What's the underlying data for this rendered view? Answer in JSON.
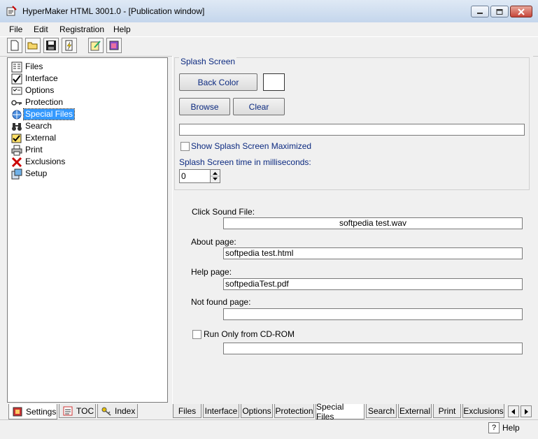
{
  "window": {
    "title": "HyperMaker HTML 3001.0 - [Publication window]"
  },
  "menu": [
    "File",
    "Edit",
    "Registration",
    "Help"
  ],
  "toolbar": {
    "buttons": [
      "new-document-icon",
      "open-folder-icon",
      "save-disk-icon",
      "build-icon",
      "edit-icon",
      "publication-icon"
    ]
  },
  "tree": {
    "items": [
      {
        "label": "Files",
        "icon": "files-icon"
      },
      {
        "label": "Interface",
        "icon": "interface-icon"
      },
      {
        "label": "Options",
        "icon": "options-icon"
      },
      {
        "label": "Protection",
        "icon": "key-icon"
      },
      {
        "label": "Special Files",
        "icon": "special-files-icon"
      },
      {
        "label": "Search",
        "icon": "binoculars-icon"
      },
      {
        "label": "External",
        "icon": "external-icon"
      },
      {
        "label": "Print",
        "icon": "printer-icon"
      },
      {
        "label": "Exclusions",
        "icon": "x-icon"
      },
      {
        "label": "Setup",
        "icon": "setup-icon"
      }
    ],
    "selected": "Special Files"
  },
  "left_tabs": [
    {
      "label": "Settings",
      "icon": "settings-icon",
      "active": true
    },
    {
      "label": "TOC",
      "icon": "toc-icon",
      "active": false
    },
    {
      "label": "Index",
      "icon": "index-key-icon",
      "active": false
    }
  ],
  "splash": {
    "group_label": "Splash Screen",
    "back_color_label": "Back Color",
    "color_swatch": "#ffffff",
    "browse_label": "Browse",
    "clear_label": "Clear",
    "path_value": "",
    "maximized_label": "Show Splash Screen Maximized",
    "maximized_checked": false,
    "time_label": "Splash Screen time in milliseconds:",
    "time_value": "0"
  },
  "files": {
    "click_sound_label": "Click Sound File:",
    "click_sound_value": "softpedia test.wav",
    "about_label": "About page:",
    "about_value": "softpedia test.html",
    "help_label": "Help page:",
    "help_value": "softpediaTest.pdf",
    "notfound_label": "Not found page:",
    "notfound_value": "",
    "cdrom_label": "Run Only from CD-ROM",
    "cdrom_checked": false,
    "cdrom_value": ""
  },
  "right_tabs": [
    {
      "label": "Files",
      "active": false
    },
    {
      "label": "Interface",
      "active": false
    },
    {
      "label": "Options",
      "active": false
    },
    {
      "label": "Protection",
      "active": false
    },
    {
      "label": "Special Files",
      "active": true
    },
    {
      "label": "Search",
      "active": false
    },
    {
      "label": "External",
      "active": false
    },
    {
      "label": "Print",
      "active": false
    },
    {
      "label": "Exclusions",
      "active": false
    }
  ],
  "status": {
    "help_label": "Help"
  },
  "colors": {
    "accent_label": "#0c2a80",
    "selection": "#3399ff"
  }
}
